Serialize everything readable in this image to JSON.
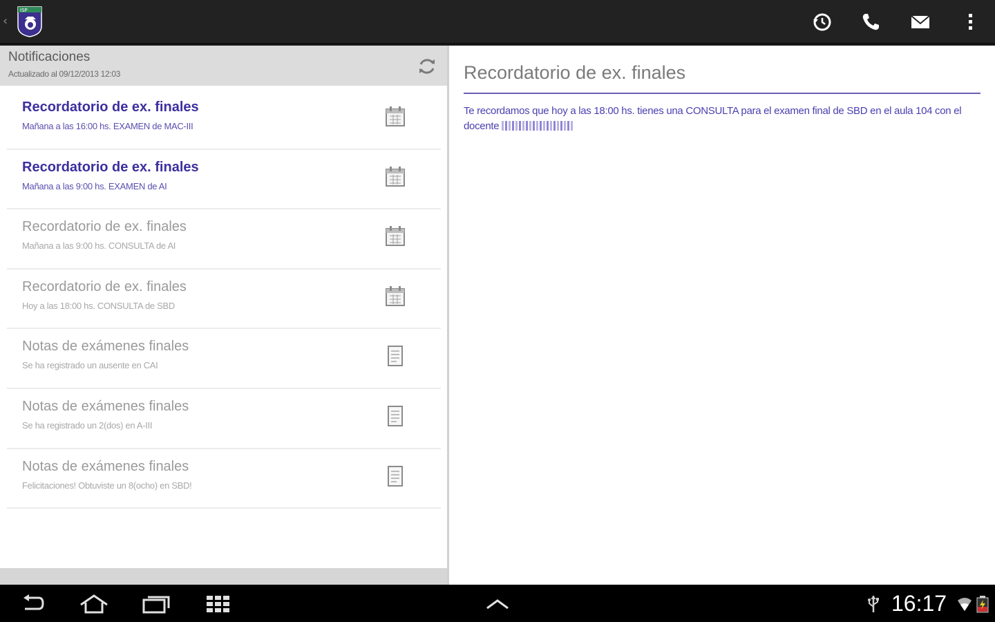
{
  "header": {
    "icons": [
      "up-caret-icon",
      "app-logo-icon",
      "history-icon",
      "phone-icon",
      "mail-icon",
      "overflow-menu-icon"
    ]
  },
  "list_header": {
    "title": "Notificaciones",
    "subtitle": "Actualizado al 09/12/2013 12:03"
  },
  "notifications": [
    {
      "title": "Recordatorio de ex. finales",
      "subtitle": "Mañana a las 16:00 hs. EXAMEN de MAC-III",
      "icon": "calendar-icon",
      "state": "unread"
    },
    {
      "title": "Recordatorio de ex. finales",
      "subtitle": "Mañana a las 9:00 hs. EXAMEN de AI",
      "icon": "calendar-icon",
      "state": "unread"
    },
    {
      "title": "Recordatorio de ex. finales",
      "subtitle": "Mañana a las 9:00 hs. CONSULTA de AI",
      "icon": "calendar-icon",
      "state": "read"
    },
    {
      "title": "Recordatorio de ex. finales",
      "subtitle": "Hoy a las 18:00 hs. CONSULTA de SBD",
      "icon": "calendar-icon",
      "state": "read"
    },
    {
      "title": "Notas de exámenes finales",
      "subtitle": "Se ha registrado un ausente en CAI",
      "icon": "document-icon",
      "state": "read"
    },
    {
      "title": "Notas de exámenes finales",
      "subtitle": "Se ha registrado un 2(dos) en A-III",
      "icon": "document-icon",
      "state": "read"
    },
    {
      "title": "Notas de exámenes finales",
      "subtitle": "Felicitaciones! Obtuviste un 8(ocho) en SBD!",
      "icon": "document-icon",
      "state": "read"
    }
  ],
  "detail": {
    "title": "Recordatorio de ex. finales",
    "body": "Te recordamos que hoy a las 18:00 hs. tienes una CONSULTA para el examen final de SBD en el aula 104 con el docente"
  },
  "navbar": {
    "clock": "16:17",
    "buttons": [
      "back-icon",
      "home-icon",
      "recent-apps-icon",
      "apps-grid-icon",
      "chevron-up-icon"
    ],
    "status_icons": [
      "usb-icon",
      "wifi-icon",
      "battery-icon"
    ]
  },
  "colors": {
    "unread_title": "#3c2f9e",
    "accent_rule": "#6b5fb5",
    "detail_text": "#4b3fb0",
    "actionbar_bg": "#222222"
  }
}
